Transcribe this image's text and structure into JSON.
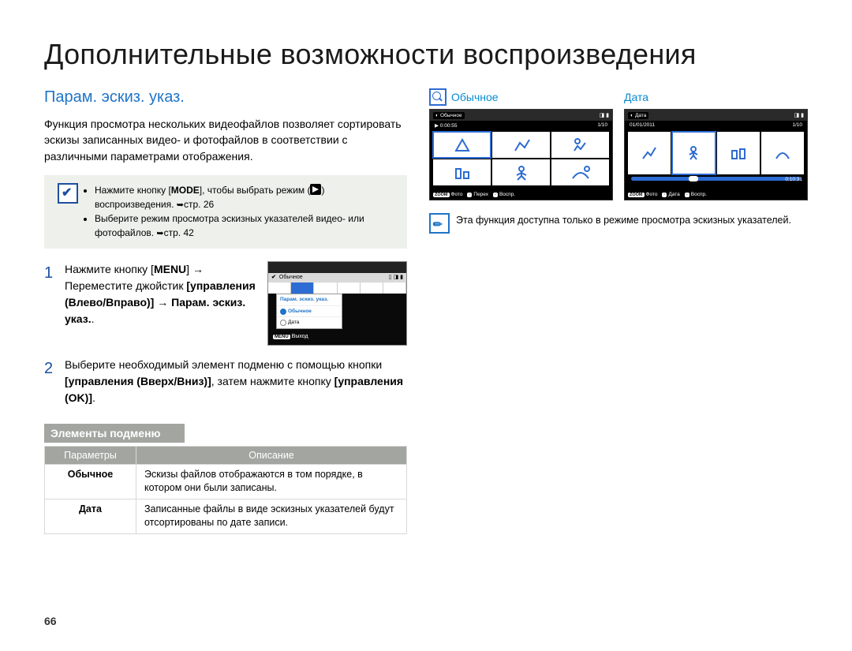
{
  "page_number": "66",
  "title": "Дополнительные возможности воспроизведения",
  "section_heading": "Парам. эскиз. указ.",
  "intro_text": "Функция просмотра нескольких видеофайлов позволяет сортировать эскизы записанных видео- и фотофайлов в соответствии с различными параметрами отображения.",
  "notebox": {
    "bullet1_pre": "Нажмите кнопку [",
    "bullet1_mode": "MODE",
    "bullet1_mid": "], чтобы выбрать режим (",
    "bullet1_post": ") воспроизведения. ",
    "bullet1_ref": "стр. 26",
    "bullet2": "Выберите режим просмотра эскизных указателей видео- или фотофайлов. ",
    "bullet2_ref": "стр. 42"
  },
  "steps": [
    {
      "num": "1",
      "l1": "Нажмите кнопку [",
      "l1b": "MENU",
      "l1post": "] → Переместите джойстик ",
      "l2b": "[управления (Влево/Вправо)]",
      "l2post": " → ",
      "l3b": "Парам. эскиз. указ.",
      "l3post": "."
    },
    {
      "num": "2",
      "l1": "Выберите необходимый элемент подменю с помощью кнопки ",
      "l1b": "[управления (Вверх/Вниз)]",
      "l1post": ", затем нажмите кнопку ",
      "l2b": "[управления (OK)]",
      "l2post": "."
    }
  ],
  "menu_screenshot": {
    "status_label": "Обычное",
    "popup_header": "Парам. эскиз. указ.",
    "item_normal": "Обычное",
    "item_date": "Дата",
    "exit_btn": "MENU",
    "exit_lbl": "Выход"
  },
  "submenu_header": "Элементы подменю",
  "table": {
    "head_param": "Параметры",
    "head_desc": "Описание",
    "rows": [
      {
        "param": "Обычное",
        "desc": "Эскизы файлов отображаются в том порядке, в котором они были записаны."
      },
      {
        "param": "Дата",
        "desc": "Записанные файлы в виде эскизных указателей будут отсортированы по дате записи."
      }
    ]
  },
  "right": {
    "label_normal": "Обычное",
    "label_date": "Дата",
    "screen_normal": {
      "top_label": "Обычное",
      "time": "0:00:55",
      "count": "1/10"
    },
    "screen_date": {
      "top_label": "Дата",
      "date": "01/01/2011",
      "count": "1/10",
      "time": "0:10:31"
    },
    "foot": {
      "zoom": "ZOOM",
      "photo": "Фото",
      "move": "Перех",
      "play": "Воспр.",
      "date": "Дата"
    },
    "note": "Эта функция доступна только в режиме просмотра эскизных указателей."
  }
}
